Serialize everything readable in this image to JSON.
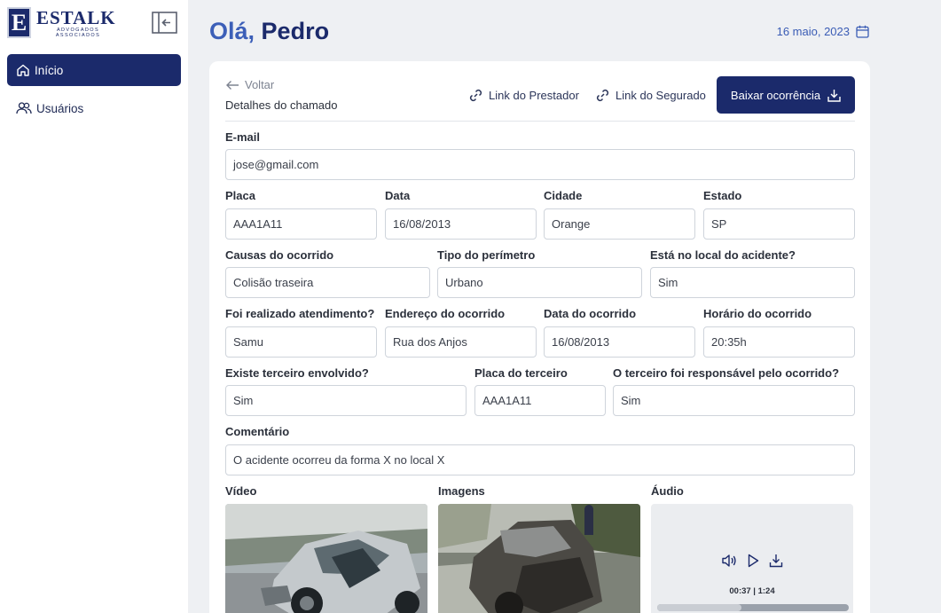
{
  "brand": {
    "name": "ESTALK",
    "mark": "E",
    "tagline": "ADVOGADOS ASSOCIADOS"
  },
  "sidebar": {
    "items": [
      {
        "label": "Início",
        "icon": "home-icon",
        "active": true
      },
      {
        "label": "Usuários",
        "icon": "users-icon",
        "active": false
      }
    ]
  },
  "header": {
    "greeting": "Olá,",
    "name": "Pedro",
    "date": "16 maio, 2023"
  },
  "detail": {
    "back_label": "Voltar",
    "subtitle": "Detalhes do chamado",
    "link_provider": "Link do Prestador",
    "link_insured": "Link do Segurado",
    "download_label": "Baixar ocorrência"
  },
  "fields": {
    "email": {
      "label": "E-mail",
      "value": "jose@gmail.com"
    },
    "placa": {
      "label": "Placa",
      "value": "AAA1A11"
    },
    "data": {
      "label": "Data",
      "value": "16/08/2013"
    },
    "cidade": {
      "label": "Cidade",
      "value": "Orange"
    },
    "estado": {
      "label": "Estado",
      "value": "SP"
    },
    "causas": {
      "label": "Causas do ocorrido",
      "value": "Colisão traseira"
    },
    "perimetro": {
      "label": "Tipo do perímetro",
      "value": "Urbano"
    },
    "local": {
      "label": "Está no local do acidente?",
      "value": "Sim"
    },
    "atendimento": {
      "label": "Foi realizado atendimento?",
      "value": "Samu"
    },
    "endereco": {
      "label": "Endereço do ocorrido",
      "value": "Rua dos Anjos"
    },
    "data_ocorrido": {
      "label": "Data do ocorrido",
      "value": "16/08/2013"
    },
    "horario": {
      "label": "Horário do ocorrido",
      "value": "20:35h"
    },
    "terceiro": {
      "label": "Existe terceiro envolvido?",
      "value": "Sim"
    },
    "placa_terceiro": {
      "label": "Placa do terceiro",
      "value": "AAA1A11"
    },
    "responsavel": {
      "label": "O terceiro foi responsável pelo ocorrido?",
      "value": "Sim"
    },
    "comentario": {
      "label": "Comentário",
      "value": "O acidente ocorreu da forma X no local X"
    }
  },
  "media": {
    "video_label": "Vídeo",
    "images_label": "Imagens",
    "audio_label": "Áudio",
    "audio_time": "00:37 | 1:24",
    "audio_progress": 0.44
  },
  "colors": {
    "primary": "#1b2a6b",
    "accent": "#3c5fb8",
    "background": "#eef0f3"
  }
}
